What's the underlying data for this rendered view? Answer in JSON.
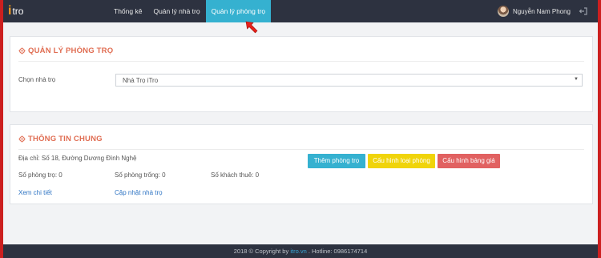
{
  "brand": {
    "logo_i": "i",
    "logo_tro": "tro"
  },
  "nav": {
    "items": [
      {
        "label": "Thống kê"
      },
      {
        "label": "Quản lý nhà trọ"
      },
      {
        "label": "Quản lý phòng trọ"
      }
    ],
    "active_index": 2
  },
  "user": {
    "name": "Nguyễn Nam Phong"
  },
  "panel_rooms": {
    "title": "QUẢN LÝ PHÒNG TRỌ",
    "select_label": "Chọn nhà trọ",
    "select_value": "Nhà Trọ iTro"
  },
  "panel_info": {
    "title": "THÔNG TIN CHUNG",
    "address": "Địa chỉ: Số 18, Đường Dương Đình Nghệ",
    "rooms": "Số phòng trọ: 0",
    "empty_rooms": "Số phòng trống: 0",
    "guests": "Số khách thuê: 0",
    "link_detail": "Xem chi tiết",
    "link_update": "Cập nhật nhà trọ",
    "btn_add": "Thêm phòng trọ",
    "btn_type": "Cấu hình loại phòng",
    "btn_price": "Cấu hình bảng giá"
  },
  "footer": {
    "prefix": "2018 © Copyright by ",
    "link": "itro.vn",
    "suffix": " . Hotline: 0986174714"
  },
  "colors": {
    "topbar": "#2d3240",
    "nav_active": "#35b1d0",
    "accent_title": "#e06d52",
    "btn_add": "#35b1d0",
    "btn_type": "#f0d40a",
    "btn_price": "#e16161",
    "arrow": "#e8201a"
  },
  "icons": {
    "title": "gear-icon",
    "logout": "logout-icon",
    "pointer": "red-arrow-pointer",
    "select": "caret-down-icon"
  }
}
